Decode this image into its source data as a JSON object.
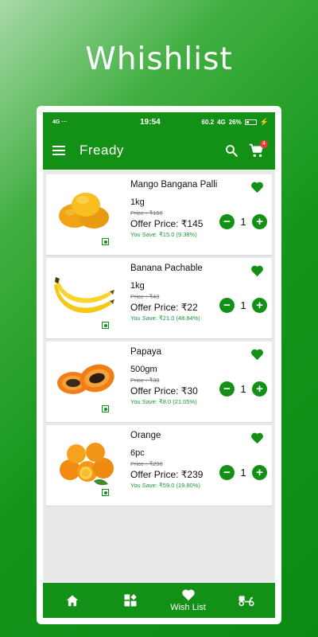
{
  "promo": {
    "title": "Whishlist"
  },
  "status": {
    "left_icons": "4G ···",
    "time": "19:54",
    "net": "60.2",
    "signal": "4G",
    "battery": "26%"
  },
  "appbar": {
    "title": "Fready",
    "cart_count": "4"
  },
  "products": [
    {
      "name": "Mango Bangana Palli",
      "qty": "1kg",
      "price": "Price : ₹160",
      "offer": "Offer Price: ₹145",
      "save": "You Save: ₹15.0 (9.38%)",
      "count": "1"
    },
    {
      "name": "Banana Pachable",
      "qty": "1kg",
      "price": "Price : ₹43",
      "offer": "Offer Price: ₹22",
      "save": "You Save: ₹21.0 (48.84%)",
      "count": "1"
    },
    {
      "name": "Papaya",
      "qty": "500gm",
      "price": "Price : ₹38",
      "offer": "Offer Price: ₹30",
      "save": "You Save: ₹8.0 (21.05%)",
      "count": "1"
    },
    {
      "name": "Orange",
      "qty": "6pc",
      "price": "Price : ₹298",
      "offer": "Offer Price: ₹239",
      "save": "You Save: ₹59.0 (19.80%)",
      "count": "1"
    }
  ],
  "nav": {
    "wishlist_label": "Wish List"
  },
  "colors": {
    "primary": "#139116",
    "save_text": "#1a9a3a",
    "badge": "#ee3b3b"
  },
  "icons": {
    "header": [
      "menu-icon",
      "search-icon",
      "cart-icon"
    ],
    "card": [
      "heart-icon",
      "minus-icon",
      "plus-icon",
      "veg-mark-icon"
    ],
    "nav": [
      "home-icon",
      "categories-icon",
      "heart-icon",
      "delivery-scooter-icon"
    ]
  }
}
